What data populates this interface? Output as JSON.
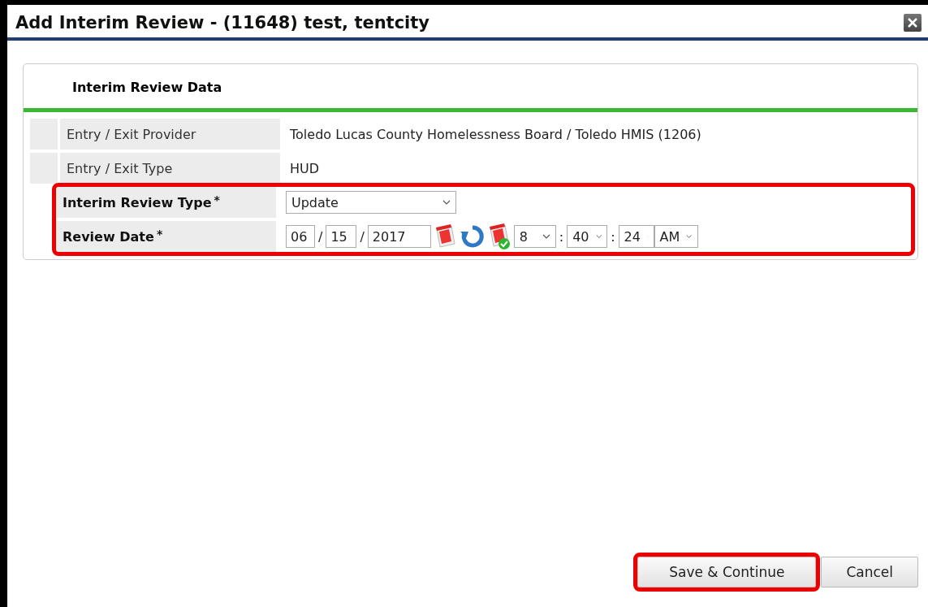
{
  "window": {
    "title": "Add Interim Review - (11648) test, tentcity"
  },
  "section": {
    "title": "Interim Review Data"
  },
  "rows": [
    {
      "kind": "text",
      "label": "Entry / Exit Provider",
      "highlighted": false,
      "value": "Toledo Lucas County Homelessness Board / Toledo HMIS (1206)"
    },
    {
      "kind": "text",
      "label": "Entry / Exit Type",
      "highlighted": false,
      "value": "HUD"
    },
    {
      "kind": "select",
      "label": "Interim Review Type",
      "required_mark": "*",
      "highlighted": true,
      "value": "Update"
    },
    {
      "kind": "datetime",
      "label": "Review Date",
      "required_mark": "*",
      "highlighted": true,
      "month": "06",
      "day": "15",
      "year": "2017",
      "date_separator": "/",
      "time_separator": ":",
      "hour": "8",
      "minute": "40",
      "second": "24",
      "ampm": "AM"
    }
  ],
  "buttons": [
    {
      "label": "Save & Continue",
      "highlighted": true
    },
    {
      "label": "Cancel",
      "highlighted": false
    }
  ]
}
